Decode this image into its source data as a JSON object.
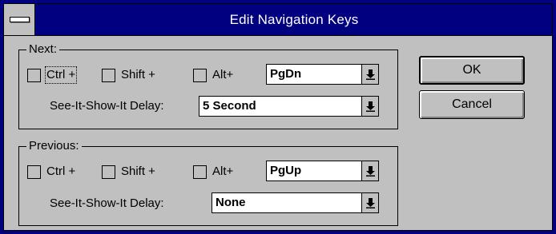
{
  "window": {
    "title": "Edit Navigation Keys"
  },
  "next": {
    "legend": "Next:",
    "ctrl_label": "Ctrl +",
    "shift_label": "Shift +",
    "alt_label": "Alt+",
    "key_value": "PgDn",
    "delay_label": "See-It-Show-It Delay:",
    "delay_value": "5 Second"
  },
  "previous": {
    "legend": "Previous:",
    "ctrl_label": "Ctrl +",
    "shift_label": "Shift +",
    "alt_label": "Alt+",
    "key_value": "PgUp",
    "delay_label": "See-It-Show-It Delay:",
    "delay_value": "None"
  },
  "buttons": {
    "ok": "OK",
    "cancel": "Cancel"
  },
  "colors": {
    "frame": "#000080",
    "face": "#c0c0c0",
    "title_text": "#ffffff"
  },
  "icons": {
    "system_menu": "system-menu-icon",
    "dropdown": "dropdown-arrow-icon"
  }
}
